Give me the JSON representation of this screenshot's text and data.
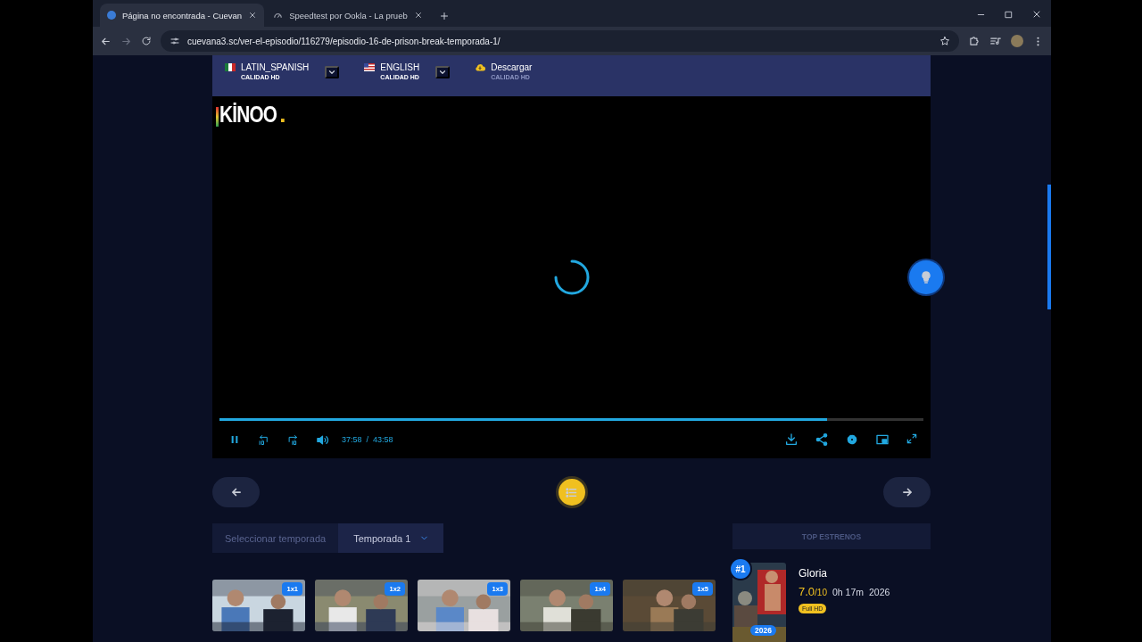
{
  "browser": {
    "tabs": [
      {
        "title": "Página no encontrada - Cuevan",
        "selected": true
      },
      {
        "title": "Speedtest por Ookla - La prueb",
        "selected": false
      }
    ],
    "url": "cuevana3.sc/ver-el-episodio/116279/episodio-16-de-prison-break-temporada-1/"
  },
  "servers": [
    {
      "kind": "mexico",
      "name": "LATIN_SPANISH",
      "quality": "CALIDAD HD"
    },
    {
      "kind": "usa",
      "name": "ENGLISH",
      "quality": "CALIDAD HD"
    },
    {
      "kind": "download",
      "name": "Descargar",
      "quality": "CALIDAD HD"
    }
  ],
  "player": {
    "logo": "KİNOO",
    "logo_mark": ".",
    "playing": true,
    "progress": {
      "level": 0.863
    },
    "elapsed": "37:58",
    "separator": "/",
    "duration": "43:58"
  },
  "season": {
    "label": "Seleccionar temporada",
    "value": "Temporada 1"
  },
  "episodes": [
    {
      "badge": "1x1"
    },
    {
      "badge": "1x2"
    },
    {
      "badge": "1x3"
    },
    {
      "badge": "1x4"
    },
    {
      "badge": "1x5"
    }
  ],
  "top": {
    "title": "TOP ESTRENOS",
    "items": [
      {
        "rank": "#1",
        "poster_badge": "2026",
        "title": "Gloria",
        "rating": "7.0",
        "scale": "/10",
        "duration": "0h 17m",
        "year": "2026",
        "quality": "Full HD"
      }
    ]
  }
}
